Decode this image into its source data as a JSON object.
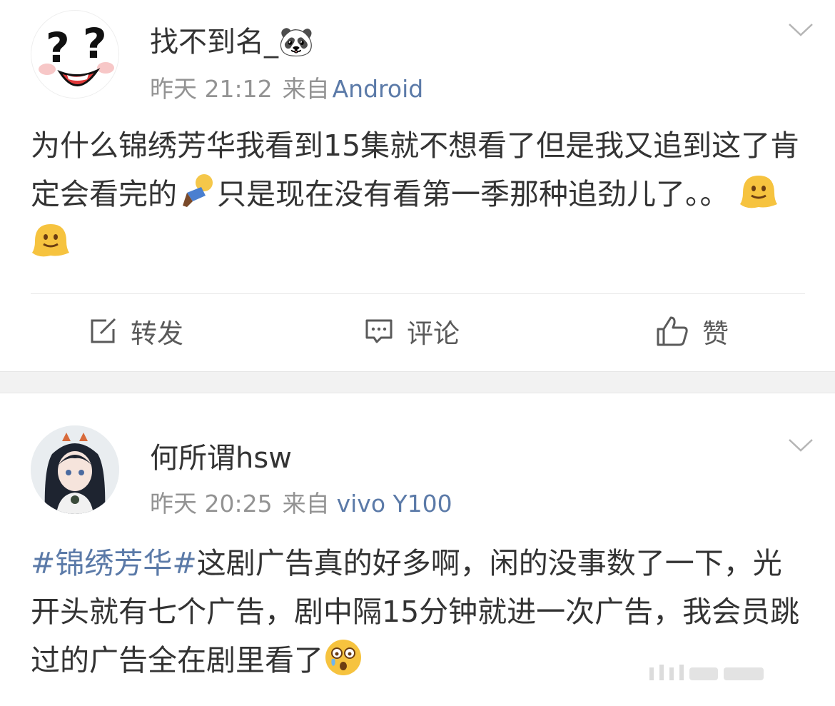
{
  "posts": [
    {
      "author": "找不到名_🐼",
      "time": "昨天 21:12",
      "source_prefix": "来自",
      "source": "Android",
      "text_parts": [
        "为什么锦绣芳华我看到15集就不想看了但是我又追到这了肯定会看完的",
        "只是现在没有看第一季那种追劲儿了。。"
      ],
      "icons": [
        "doll-emoji-icon",
        "melting-face-emoji-icon",
        "melting-face-emoji-icon"
      ],
      "actions": {
        "repost": "转发",
        "comment": "评论",
        "like": "赞"
      }
    },
    {
      "author": "何所谓hsw",
      "time": "昨天 20:25",
      "source_prefix": "来自",
      "source": "vivo Y100",
      "topic": "#锦绣芳华#",
      "text": "这剧广告真的好多啊，闲的没事数了一下，光开头就有七个广告，剧中隔15分钟就进一次广告，我会员跳过的广告全在剧里看了",
      "icons": [
        "astonished-face-emoji-icon"
      ]
    }
  ],
  "colors": {
    "link": "#5b7aa8",
    "meta": "#939393",
    "text": "#333333",
    "separator": "#f2f2f2"
  }
}
